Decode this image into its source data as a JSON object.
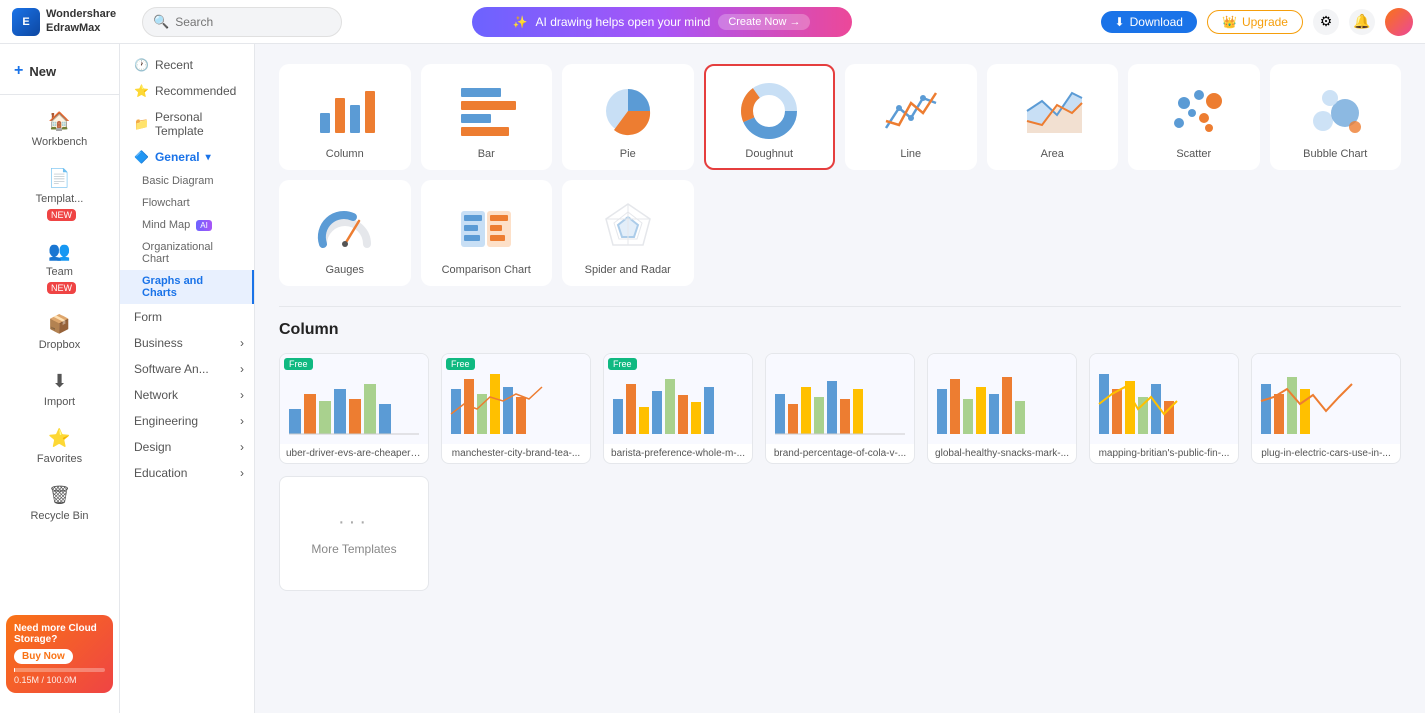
{
  "topbar": {
    "logo_line1": "Wondershare",
    "logo_line2": "EdrawMax",
    "search_placeholder": "Search",
    "ai_banner_text": "AI drawing helps open your mind",
    "ai_banner_btn": "Create Now →",
    "download_label": "Download",
    "upgrade_label": "Upgrade"
  },
  "sidebar": {
    "new_label": "New",
    "items": [
      {
        "id": "workbench",
        "label": "Workbench",
        "icon": "🏠"
      },
      {
        "id": "templates",
        "label": "Templat...",
        "icon": "📄",
        "badge": "NEW"
      },
      {
        "id": "team",
        "label": "Team",
        "icon": "👥",
        "badge": "NEW"
      },
      {
        "id": "dropbox",
        "label": "Dropbox",
        "icon": "📦"
      },
      {
        "id": "import",
        "label": "Import",
        "icon": "⬇"
      },
      {
        "id": "favorites",
        "label": "Favorites",
        "icon": "⭐"
      },
      {
        "id": "recycle",
        "label": "Recycle Bin",
        "icon": "🗑"
      }
    ],
    "cloud_storage": {
      "title": "Need more Cloud Storage?",
      "btn": "Buy Now",
      "used": "0.15M",
      "total": "100.0M"
    }
  },
  "left_nav": {
    "recent": "Recent",
    "recommended": "Recommended",
    "personal_template": "Personal Template",
    "general": "General",
    "sub_items": [
      {
        "id": "basic-diagram",
        "label": "Basic Diagram"
      },
      {
        "id": "flowchart",
        "label": "Flowchart"
      },
      {
        "id": "mind-map",
        "label": "Mind Map",
        "badge": "AI"
      },
      {
        "id": "org-chart",
        "label": "Organizational Chart"
      },
      {
        "id": "graphs-charts",
        "label": "Graphs and Charts",
        "active": true
      }
    ],
    "form": "Form",
    "sections": [
      {
        "id": "business",
        "label": "Business"
      },
      {
        "id": "software",
        "label": "Software An..."
      },
      {
        "id": "network",
        "label": "Network"
      },
      {
        "id": "engineering",
        "label": "Engineering"
      },
      {
        "id": "design",
        "label": "Design"
      },
      {
        "id": "education",
        "label": "Education"
      }
    ]
  },
  "chart_types": [
    {
      "id": "column",
      "label": "Column"
    },
    {
      "id": "bar",
      "label": "Bar"
    },
    {
      "id": "pie",
      "label": "Pie"
    },
    {
      "id": "doughnut",
      "label": "Doughnut",
      "selected": true
    },
    {
      "id": "line",
      "label": "Line"
    },
    {
      "id": "area",
      "label": "Area"
    },
    {
      "id": "scatter",
      "label": "Scatter"
    },
    {
      "id": "bubble",
      "label": "Bubble Chart"
    },
    {
      "id": "gauges",
      "label": "Gauges"
    },
    {
      "id": "comparison",
      "label": "Comparison Chart"
    },
    {
      "id": "spider",
      "label": "Spider and Radar"
    }
  ],
  "section_title": "Column",
  "templates": [
    {
      "id": "t1",
      "title": "uber-driver-evs-are-cheaper-...",
      "free": true
    },
    {
      "id": "t2",
      "title": "manchester-city-brand-tea-...",
      "free": true
    },
    {
      "id": "t3",
      "title": "barista-preference-whole-m-...",
      "free": true
    },
    {
      "id": "t4",
      "title": "brand-percentage-of-cola-v-..."
    },
    {
      "id": "t5",
      "title": "global-healthy-snacks-mark-..."
    },
    {
      "id": "t6",
      "title": "mapping-britian's-public-fin-..."
    },
    {
      "id": "t7",
      "title": "plug-in-electric-cars-use-in-..."
    }
  ],
  "more_templates_label": "More Templates"
}
